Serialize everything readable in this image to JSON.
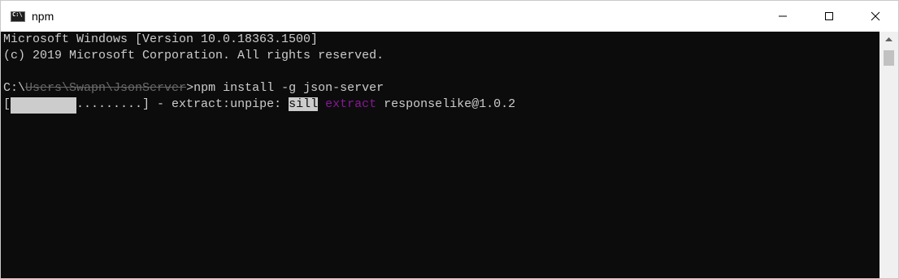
{
  "window": {
    "title": "npm"
  },
  "console": {
    "lines": [
      "Microsoft Windows [Version 10.0.18363.1500]",
      "(c) 2019 Microsoft Corporation. All rights reserved.",
      ""
    ],
    "prompt": {
      "path_visible": "C:\\",
      "path_obscured": "Users\\Swapn\\JsonServer",
      "command": ">npm install -g json-server"
    },
    "progress": {
      "open": "[",
      "remaining": ".........",
      "close": "]",
      "fill_fraction": 0.5,
      "status": " - extract:unpipe: ",
      "level": "sill",
      "action": "extract",
      "package": " responselike@1.0.2"
    }
  },
  "colors": {
    "background": "#0c0c0c",
    "foreground": "#cccccc",
    "magenta": "#881798"
  },
  "icons": [
    "cmd-app-icon",
    "minimize-icon",
    "maximize-icon",
    "close-icon",
    "scroll-up-arrow-icon"
  ]
}
